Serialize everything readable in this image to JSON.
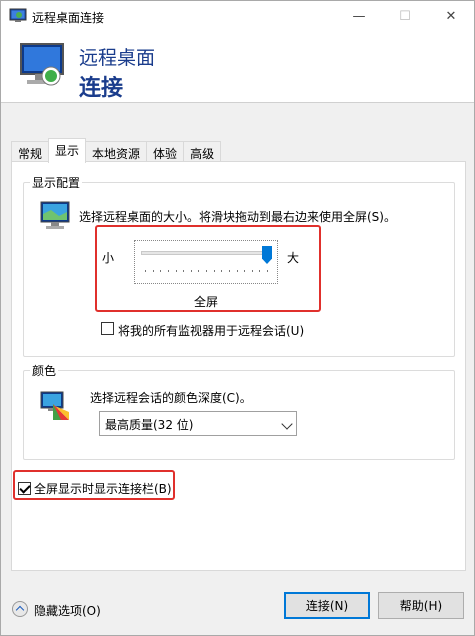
{
  "window": {
    "title": "远程桌面连接",
    "minimize_glyph": "—",
    "maximize_glyph": "☐",
    "close_glyph": "✕"
  },
  "header": {
    "line1": "远程桌面",
    "line2": "连接"
  },
  "tabs": [
    {
      "label": "常规",
      "active": false
    },
    {
      "label": "显示",
      "active": true
    },
    {
      "label": "本地资源",
      "active": false
    },
    {
      "label": "体验",
      "active": false
    },
    {
      "label": "高级",
      "active": false
    }
  ],
  "display_config": {
    "group_label": "显示配置",
    "description": "选择远程桌面的大小。将滑块拖动到最右边来使用全屏(S)。",
    "slider_min_label": "小",
    "slider_max_label": "大",
    "slider_value_label": "全屏",
    "slider_position": 1.0,
    "use_all_monitors": {
      "label": "将我的所有监视器用于远程会话(U)",
      "checked": false
    }
  },
  "colors": {
    "group_label": "颜色",
    "description": "选择远程会话的颜色深度(C)。",
    "selected": "最高质量(32 位)"
  },
  "connection_bar": {
    "label": "全屏显示时显示连接栏(B)",
    "checked": true
  },
  "footer": {
    "hide_options": "隐藏选项(O)",
    "connect_button": "连接(N)",
    "help_button": "帮助(H)"
  },
  "icons": {
    "app": "remote-desktop-icon",
    "header": "remote-desktop-large-icon",
    "display": "monitor-icon",
    "colors": "color-palette-icon",
    "hide": "chevron-up-icon"
  },
  "accent_color": "#0078d7",
  "highlight_color": "#e0302c"
}
